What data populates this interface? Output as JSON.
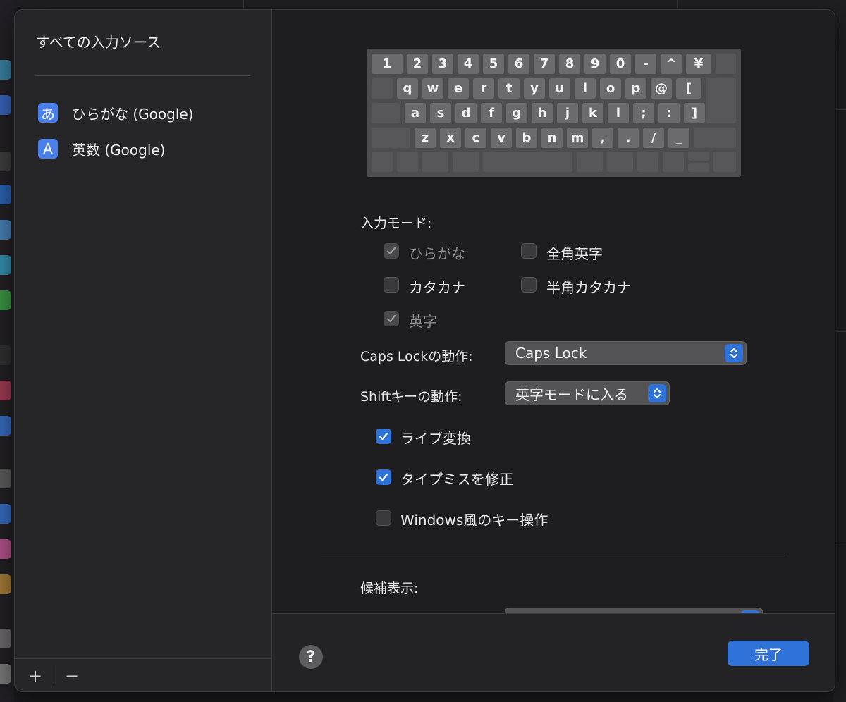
{
  "colors": {
    "accent": "#2f72d8",
    "badge": "#4a7ee8",
    "sidebar": "#262628",
    "panel": "#1e1e20"
  },
  "sidebar": {
    "title": "すべての入力ソース",
    "items": [
      {
        "badge": "あ",
        "label": "ひらがな (Google)"
      },
      {
        "badge": "A",
        "label": "英数 (Google)"
      }
    ],
    "add_label": "+",
    "remove_label": "−"
  },
  "keyboard": {
    "row1": [
      "1",
      "2",
      "3",
      "4",
      "5",
      "6",
      "7",
      "8",
      "9",
      "0",
      "-",
      "^",
      "¥"
    ],
    "row2": [
      "q",
      "w",
      "e",
      "r",
      "t",
      "y",
      "u",
      "i",
      "o",
      "p",
      "@",
      "["
    ],
    "row3": [
      "a",
      "s",
      "d",
      "f",
      "g",
      "h",
      "j",
      "k",
      "l",
      ";",
      ":",
      "]"
    ],
    "row4": [
      "z",
      "x",
      "c",
      "v",
      "b",
      "n",
      "m",
      ",",
      ".",
      "/",
      "_"
    ]
  },
  "input_mode": {
    "label": "入力モード:",
    "hiragana": {
      "label": "ひらがな",
      "checked": true,
      "disabled": true
    },
    "zenkaku_eiji": {
      "label": "全角英字",
      "checked": false
    },
    "katakana": {
      "label": "カタカナ",
      "checked": false
    },
    "hankaku_katakana": {
      "label": "半角カタカナ",
      "checked": false
    },
    "eiji": {
      "label": "英字",
      "checked": true,
      "disabled": true
    }
  },
  "caps_lock": {
    "label": "Caps Lockの動作:",
    "value": "Caps Lock"
  },
  "shift_key": {
    "label": "Shiftキーの動作:",
    "value": "英字モードに入る"
  },
  "options": {
    "live_conversion": {
      "label": "ライブ変換",
      "checked": true
    },
    "typo_correction": {
      "label": "タイプミスを修正",
      "checked": true
    },
    "windows_keys": {
      "label": "Windows風のキー操作",
      "checked": false
    }
  },
  "candidates": {
    "label": "候補表示:"
  },
  "footer": {
    "help_label": "?",
    "done_label": "完了"
  }
}
